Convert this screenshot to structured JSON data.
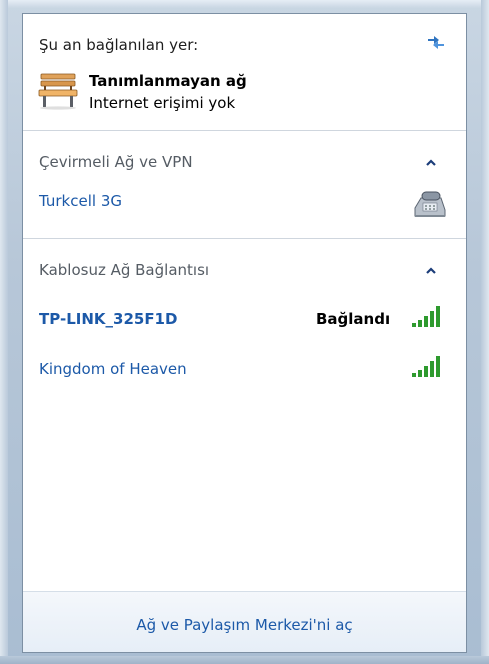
{
  "current_connection": {
    "title": "Şu an bağlanılan yer:",
    "network_name": "Tanımlanmayan ağ",
    "network_status": "Internet erişimi yok",
    "network_icon": "bench-icon",
    "refresh_icon": "refresh-icon"
  },
  "dialup_section": {
    "header": "Çevirmeli Ağ ve VPN",
    "items": [
      {
        "label": "Turkcell 3G",
        "icon": "dialup-phone-icon"
      }
    ]
  },
  "wireless_section": {
    "header": "Kablosuz Ağ Bağlantısı",
    "items": [
      {
        "label": "TP-LINK_325F1D",
        "status": "Bağlandı",
        "connected": true,
        "signal_bars": 5
      },
      {
        "label": "Kingdom of Heaven",
        "status": "",
        "connected": false,
        "signal_bars": 5
      }
    ]
  },
  "footer": {
    "link_label": "Ağ ve Paylaşım Merkezi'ni aç"
  },
  "colors": {
    "link": "#1c59a8",
    "header_text": "#555c64",
    "signal": "#2e9a2e",
    "flyout_bg": "#ffffff"
  }
}
